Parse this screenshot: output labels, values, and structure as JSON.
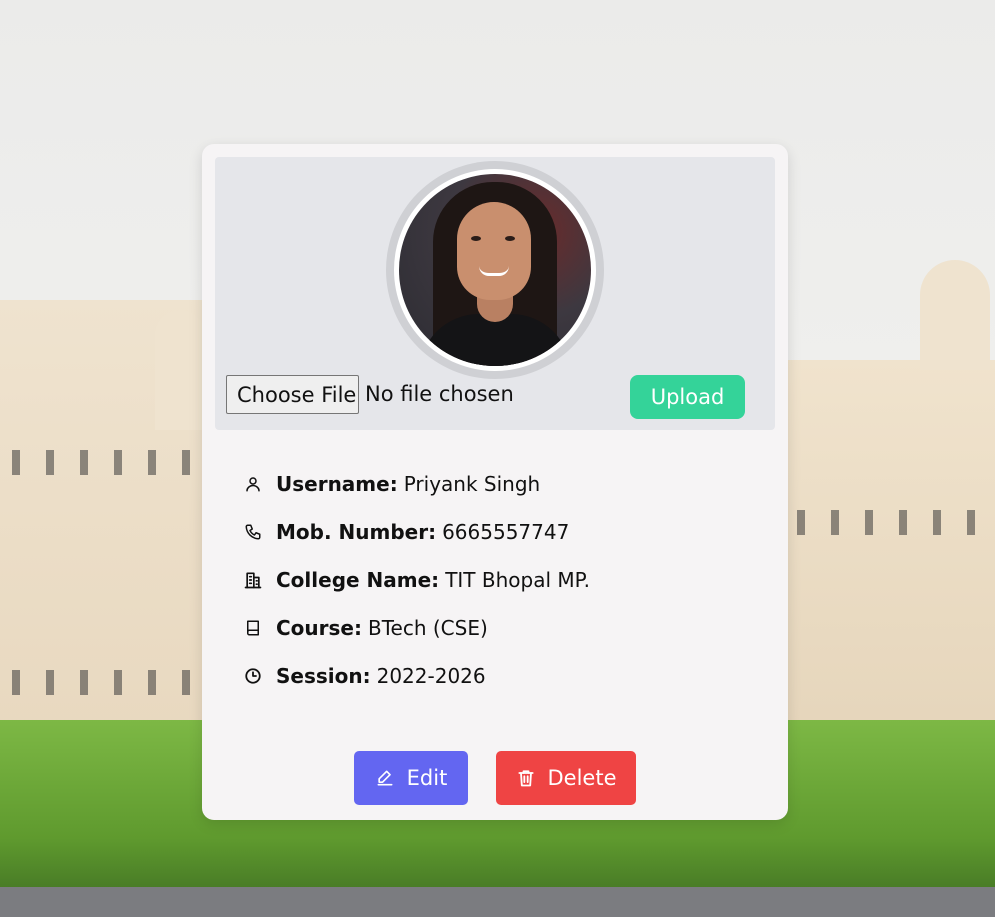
{
  "upload": {
    "choose_file_label": "Choose File",
    "file_status": "No file chosen",
    "upload_label": "Upload"
  },
  "profile": {
    "fields": [
      {
        "icon": "user-icon",
        "label": "Username:",
        "value": "Priyank Singh"
      },
      {
        "icon": "phone-icon",
        "label": "Mob. Number:",
        "value": "6665557747"
      },
      {
        "icon": "building-icon",
        "label": "College Name:",
        "value": "TIT Bhopal MP."
      },
      {
        "icon": "book-icon",
        "label": "Course:",
        "value": "BTech (CSE)"
      },
      {
        "icon": "clock-icon",
        "label": "Session:",
        "value": "2022-2026"
      }
    ]
  },
  "actions": {
    "edit_label": "Edit",
    "delete_label": "Delete"
  },
  "colors": {
    "upload": "#34d399",
    "edit": "#6366f1",
    "delete": "#ef4444",
    "card": "#f6f4f5",
    "header": "#e5e6ea"
  }
}
